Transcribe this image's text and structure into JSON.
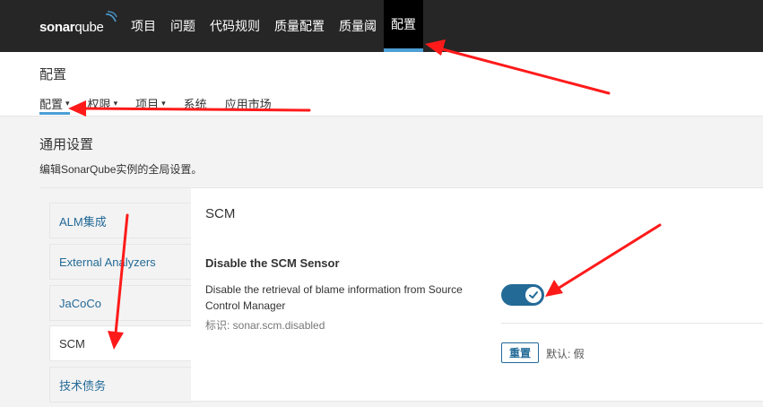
{
  "header": {
    "logo": {
      "part1": "sonar",
      "part2": "qube"
    },
    "nav": [
      "项目",
      "问题",
      "代码规则",
      "质量配置",
      "质量阈",
      "配置"
    ]
  },
  "page": {
    "title": "配置",
    "subnav": [
      {
        "label": "配置",
        "caret": "▾"
      },
      {
        "label": "权限",
        "caret": "▾"
      },
      {
        "label": "项目",
        "caret": "▾"
      },
      {
        "label": "系统",
        "caret": ""
      },
      {
        "label": "应用市场",
        "caret": ""
      }
    ]
  },
  "general": {
    "title": "通用设置",
    "description": "编辑SonarQube实例的全局设置。"
  },
  "categories": [
    "ALM集成",
    "External Analyzers",
    "JaCoCo",
    "SCM",
    "技术债务"
  ],
  "panel": {
    "title": "SCM",
    "setting": {
      "name": "Disable the SCM Sensor",
      "description": "Disable the retrieval of blame information from Source Control Manager",
      "key": "标识: sonar.scm.disabled",
      "enabled": true
    },
    "reset_label": "重置",
    "default_text": "默认: 假"
  },
  "colors": {
    "accent": "#236a97",
    "active_underline": "#4b9fd5",
    "annotation": "#ff1a1a"
  },
  "icons": [
    "checkmark-icon",
    "caret-down-icon",
    "sonarqube-logo-icon"
  ]
}
